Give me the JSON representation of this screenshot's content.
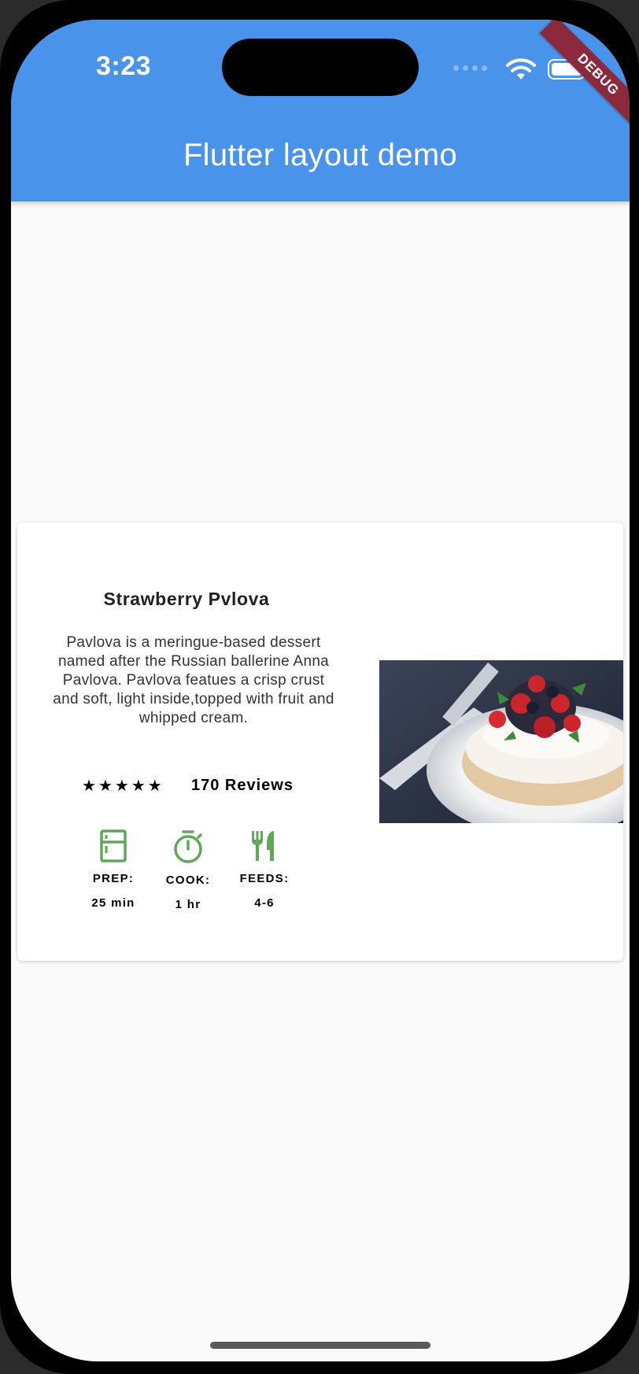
{
  "status_bar": {
    "time": "3:23"
  },
  "app_bar": {
    "title": "Flutter layout demo",
    "background": "#4a93ea"
  },
  "debug_banner": {
    "label": "DEBUG",
    "color": "#8b2a3c"
  },
  "recipe": {
    "title": "Strawberry Pvlova",
    "description": "Pavlova is a meringue-based dessert named after the Russian ballerine Anna Pavlova. Pavlova featues a crisp crust and soft, light inside,topped with fruit and whipped cream.",
    "rating": {
      "stars": 5,
      "reviews_label": "170 Reviews"
    },
    "info": [
      {
        "icon": "kitchen-icon",
        "label": "PREP:",
        "value": "25 min"
      },
      {
        "icon": "timer-icon",
        "label": "COOK:",
        "value": "1 hr"
      },
      {
        "icon": "restaurant-icon",
        "label": "FEEDS:",
        "value": "4-6"
      }
    ],
    "accent_color": "#5ea85a"
  }
}
